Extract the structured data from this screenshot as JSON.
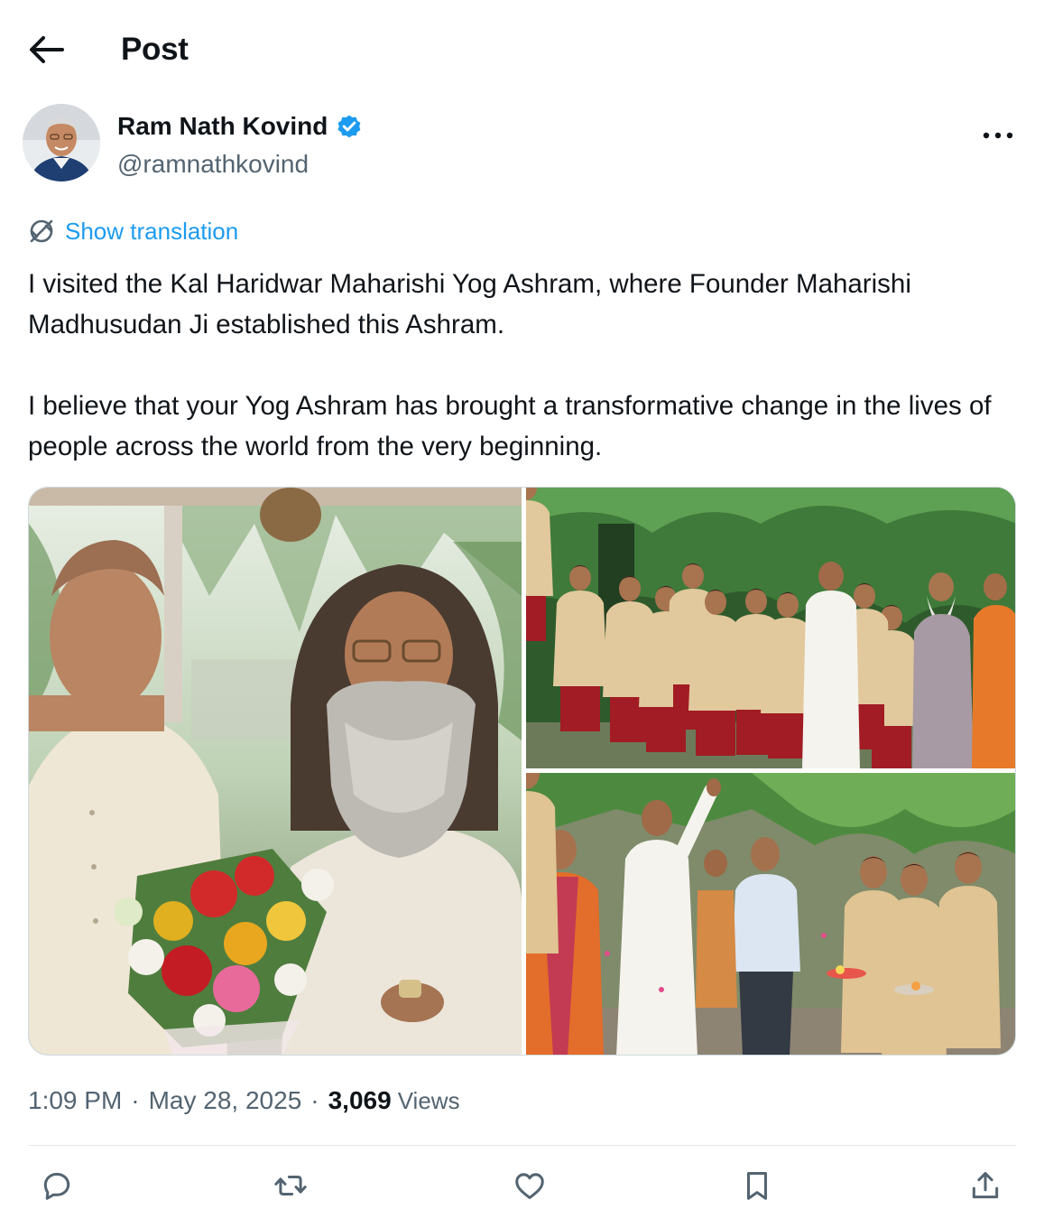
{
  "header": {
    "title": "Post",
    "back_icon": "arrow-left-icon"
  },
  "author": {
    "name": "Ram Nath Kovind",
    "handle": "@ramnathkovind",
    "verified": true,
    "verified_color": "#1d9bf0"
  },
  "translate": {
    "label": "Show translation",
    "icon": "globe-translate-icon"
  },
  "tweet": {
    "paragraphs": [
      "I visited the Kal Haridwar Maharishi Yog Ashram, where Founder Maharishi Madhusudan Ji established this Ashram.",
      "I believe that your Yog Ashram has brought a transformative change in the lives of people across the world from the very beginning."
    ]
  },
  "media": {
    "count": 3,
    "photos": [
      {
        "icon": "photo-two-men-with-bouquet"
      },
      {
        "icon": "photo-group-with-students"
      },
      {
        "icon": "photo-welcome-ceremony"
      }
    ]
  },
  "meta": {
    "time": "1:09 PM",
    "separator": "·",
    "date": "May 28, 2025",
    "views_count": "3,069",
    "views_label": "Views"
  },
  "actions": {
    "reply_icon": "reply-icon",
    "retweet_icon": "retweet-icon",
    "like_icon": "like-icon",
    "bookmark_icon": "bookmark-icon",
    "share_icon": "share-icon"
  },
  "colors": {
    "text": "#0f1419",
    "secondary": "#536471",
    "accent": "#1d9bf0",
    "divider": "#e1e8ed"
  }
}
